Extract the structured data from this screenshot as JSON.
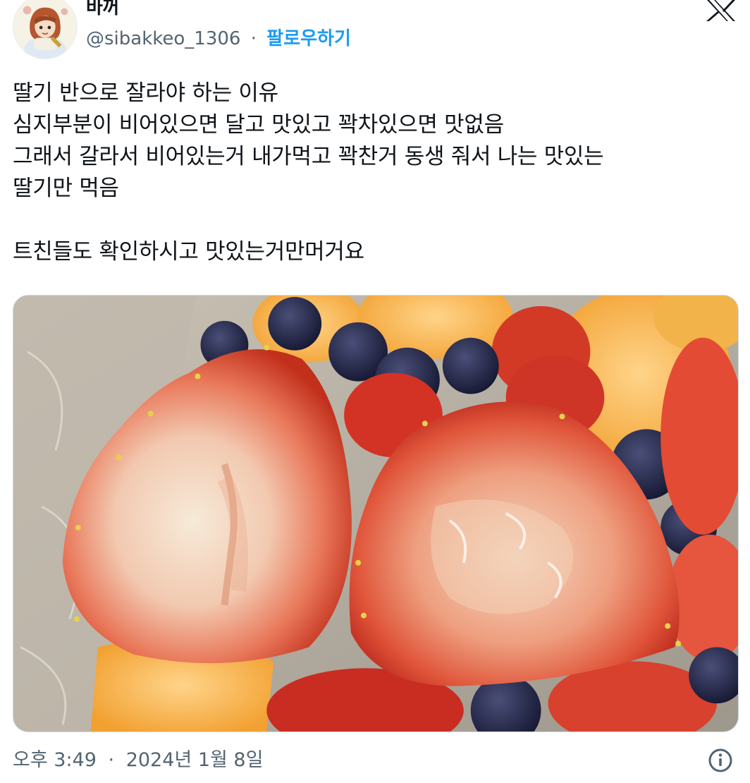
{
  "author": {
    "display_name": "바꺼",
    "handle": "@sibakkeo_1306",
    "separator": "·",
    "follow_label": "팔로우하기"
  },
  "tweet": {
    "lines": [
      "딸기 반으로 잘라야 하는 이유",
      "심지부분이 비어있으면 달고 맛있고 꽉차있으면 맛없음",
      "그래서 갈라서 비어있는거 내가먹고 꽉찬거 동생 줘서 나는 맛있는",
      "딸기만 먹음",
      "트친들도 확인하시고 맛있는거만머거요"
    ]
  },
  "footer": {
    "time": "오후 3:49",
    "separator": "·",
    "date": "2024년 1월 8일"
  },
  "icons": {
    "logo": "x-logo-icon",
    "info": "info-icon"
  },
  "colors": {
    "text": "#0f1419",
    "secondary": "#536471",
    "accent": "#1d9bf0"
  }
}
